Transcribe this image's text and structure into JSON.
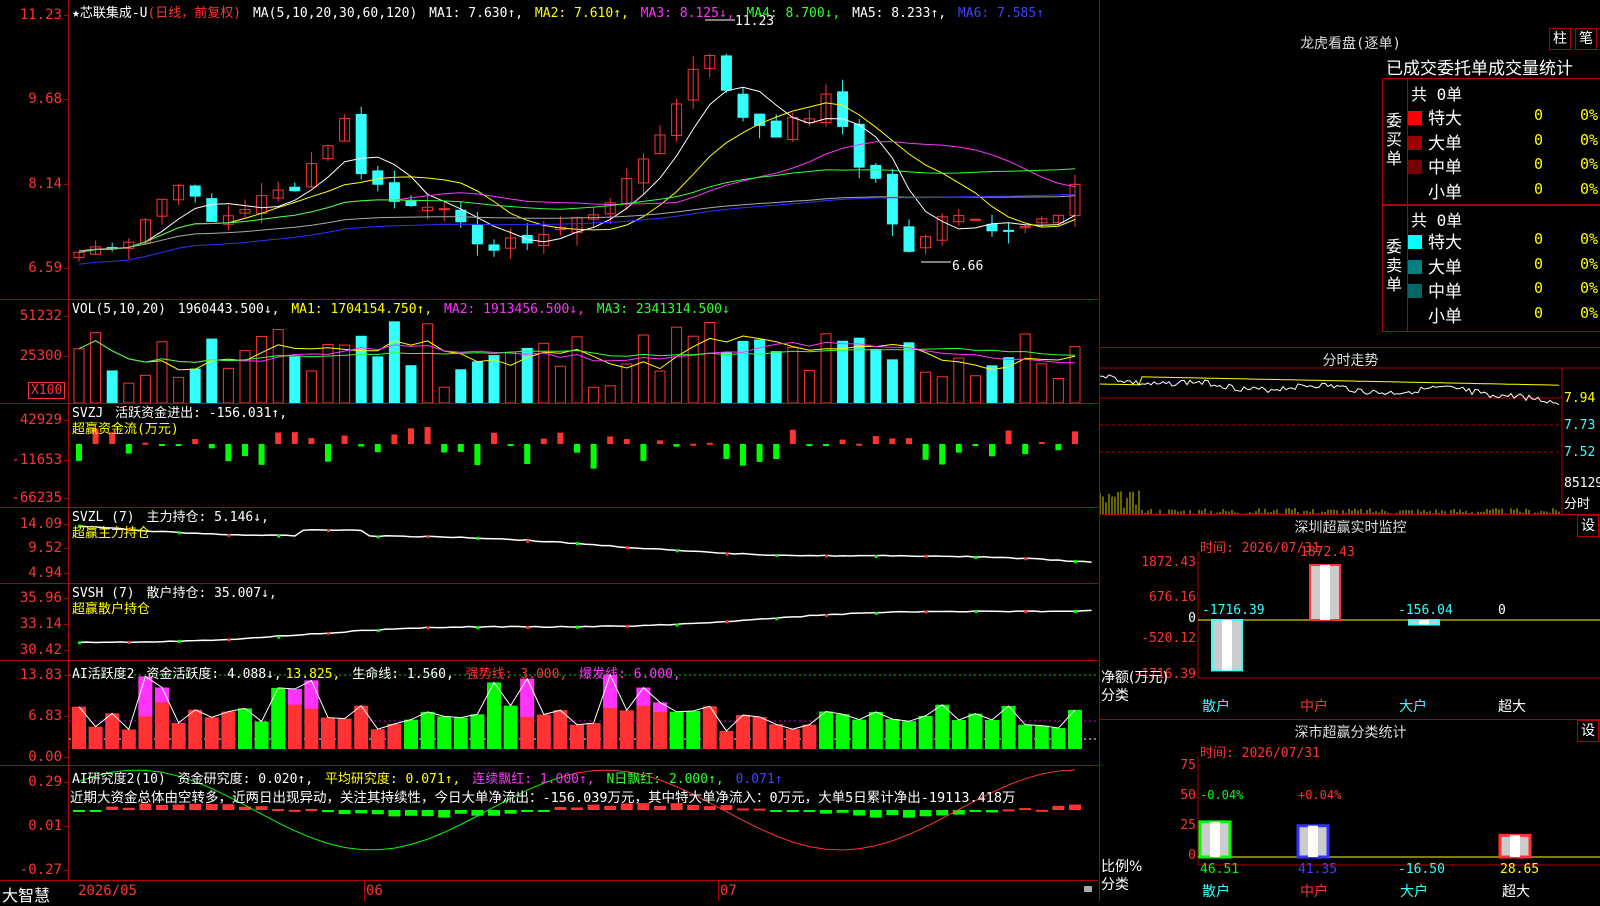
{
  "app": {
    "logo": "大智慧",
    "window_tab": "★芯联集成-U",
    "window_suffix": "(日线，前复权)"
  },
  "colors": {
    "up": "#ff3333",
    "down": "#33ffff",
    "ma1": "#ffffff",
    "ma2": "#ffff00",
    "ma3": "#ff33ff",
    "ma4": "#33ff33",
    "ma5": "#aaaaaa",
    "ma6": "#3030ff",
    "grid": "#b00000"
  },
  "kline": {
    "ma_spec": "MA(5,10,20,30,60,120)",
    "ma1": "MA1: 7.630↑,",
    "ma2": "MA2: 7.610↑,",
    "ma3": "MA3: 8.125↓,",
    "ma4": "MA4: 8.700↓,",
    "ma5": "MA5: 8.233↑,",
    "ma6": "MA6: 7.585↑",
    "y_ticks": [
      "11.23",
      "9.68",
      "8.14",
      "6.59"
    ],
    "high_label": "11.23",
    "low_label": "6.66",
    "ymin": 6.4,
    "ymax": 11.6
  },
  "vol": {
    "title": "VOL(5,10,20)",
    "value": "1960443.500↓,",
    "ma1": "MA1: 1704154.750↑,",
    "ma2": "MA2: 1913456.500↓,",
    "ma3": "MA3: 2341314.500↓",
    "y_ticks": [
      "51232",
      "25300"
    ],
    "unit": "X100",
    "ymax": 56000
  },
  "svzj": {
    "title": "SVZJ",
    "desc": "活跃资金进出: -156.031↑,",
    "subtitle": "超赢资金流(万元)",
    "y_ticks": [
      "42929",
      "-11653",
      "-66235"
    ]
  },
  "svzl": {
    "title": "SVZL (7)",
    "desc": "主力持仓: 5.146↓,",
    "subtitle": "超赢主力持仓",
    "y_ticks": [
      "14.09",
      "9.52",
      "4.94"
    ]
  },
  "svsh": {
    "title": "SVSH (7)",
    "desc": "散户持仓: 35.007↓,",
    "subtitle": "超赢散户持仓",
    "y_ticks": [
      "35.96",
      "33.14",
      "30.42"
    ]
  },
  "ai1": {
    "title": "AI活跃度2",
    "desc": "资金活跃度: 4.088↓,",
    "v2": "13.825,",
    "life": "生命线: 1.560,",
    "strong": "强势线: 3.000,",
    "burst": "爆发线: 6.000,",
    "y_ticks": [
      "13.83",
      "6.83",
      "0.00"
    ]
  },
  "ai2": {
    "title": "AI研究度2(10)",
    "desc": "资金研究度: 0.020↑,",
    "avg": "平均研究度: 0.071↑,",
    "streak": "连续飘红: 1.000↑,",
    "nday": "N日飘红: 2.000↑,",
    "last": "0.071↑",
    "comment": "近期大资金总体由空转多，近两日出现异动，关注其持续性，今日大单净流出：-156.039万元，其中特大单净流入：0万元，大单5日累计净出-19113.418万",
    "y_ticks": [
      "0.29",
      "0.01",
      "-0.27"
    ]
  },
  "xaxis": {
    "labels": [
      "2026/05",
      "06",
      "07"
    ]
  },
  "longhu": {
    "title": "龙虎看盘(逐单)",
    "btn_bar": "柱",
    "btn_pen": "笔",
    "header": "已成交委托单成交量统计",
    "buy_label": "委买单",
    "sell_label": "委卖单",
    "buy_total": "共 0单",
    "sell_total": "共 0单",
    "rows": [
      {
        "name": "特大",
        "val": "0",
        "pct": "0%"
      },
      {
        "name": "大单",
        "val": "0",
        "pct": "0%"
      },
      {
        "name": "中单",
        "val": "0",
        "pct": "0%"
      },
      {
        "name": "小单",
        "val": "0",
        "pct": "0%"
      }
    ],
    "sell_rows": [
      {
        "name": "特大",
        "val": "0",
        "pct": "0%"
      },
      {
        "name": "大单",
        "val": "0",
        "pct": "0%"
      },
      {
        "name": "中单",
        "val": "0",
        "pct": "0%"
      },
      {
        "name": "小单",
        "val": "0",
        "pct": "0%"
      }
    ]
  },
  "fenshi": {
    "title": "分时走势",
    "y_ticks": [
      "7.94",
      "7.73",
      "7.52"
    ],
    "vol_label": "85129",
    "x_label": "分时"
  },
  "monitor": {
    "title": "深圳超赢实时监控",
    "btn": "设",
    "time": "时间: 2026/07/31",
    "y_ticks": [
      "1872.43",
      "676.16",
      "0",
      "-520.12",
      "-1716.39"
    ],
    "ylabel": "净额(万元)",
    "xlabel": "分类",
    "categories": [
      "散户",
      "中户",
      "大户",
      "超大"
    ],
    "values": [
      -1716.39,
      1872.43,
      -156.04,
      0
    ],
    "value_labels": [
      "-1716.39",
      "1872.43",
      "-156.04",
      "0"
    ]
  },
  "classify": {
    "title": "深市超赢分类统计",
    "btn": "设",
    "time": "时间: 2026/07/31",
    "y_ticks": [
      "75",
      "50",
      "25",
      "0"
    ],
    "ylabel": "比例%",
    "xlabel": "分类",
    "categories": [
      "散户",
      "中户",
      "大户",
      "超大"
    ],
    "values": [
      46.51,
      41.35,
      -16.5,
      28.65
    ],
    "value_labels": [
      "46.51",
      "41.35",
      "-16.50",
      "28.65"
    ],
    "delta_labels": [
      "-0.04%",
      "+0.04%"
    ]
  }
}
